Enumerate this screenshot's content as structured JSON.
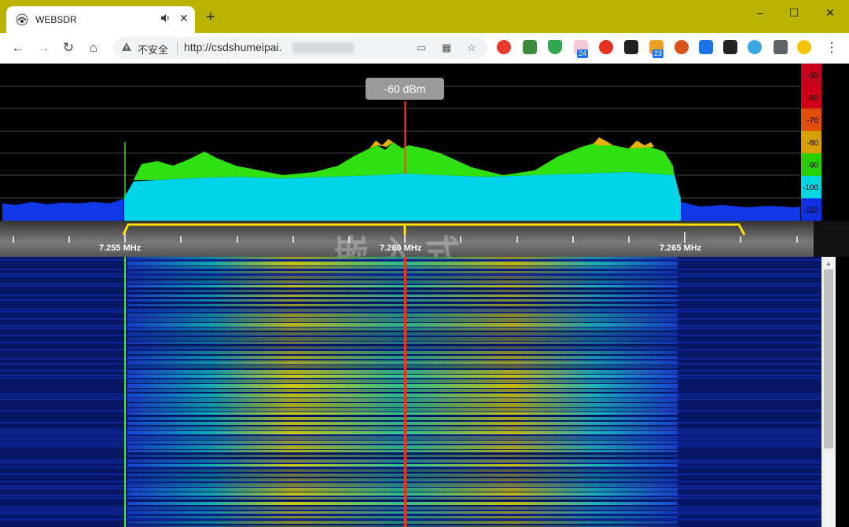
{
  "browser": {
    "tab_title": "WEBSDR",
    "tab_audio_icon": "speaker-icon",
    "tab_close_glyph": "✕",
    "new_tab_glyph": "+",
    "window_controls": {
      "minimize": "–",
      "maximize": "☐",
      "close": "✕"
    },
    "address": {
      "security_label": "不安全",
      "url": "http://csdshumeipai."
    },
    "extension_badges": [
      "24",
      "23"
    ]
  },
  "spectrum": {
    "marker_label": "-60 dBm",
    "db_scale": [
      "-50",
      "-60",
      "-70",
      "-80",
      "-90",
      "-100",
      "-110"
    ],
    "db_scale_colors": [
      "#c8001e",
      "#d00018",
      "#e04e0a",
      "#d8a000",
      "#28d000",
      "#00d6e0",
      "#1030e0"
    ]
  },
  "frequency_scale": {
    "labels": [
      "7.255 MHz",
      "7.260 MHz",
      "7.265 MHz"
    ],
    "passband_color": "#ffe000"
  },
  "watermark": "嵌入式"
}
